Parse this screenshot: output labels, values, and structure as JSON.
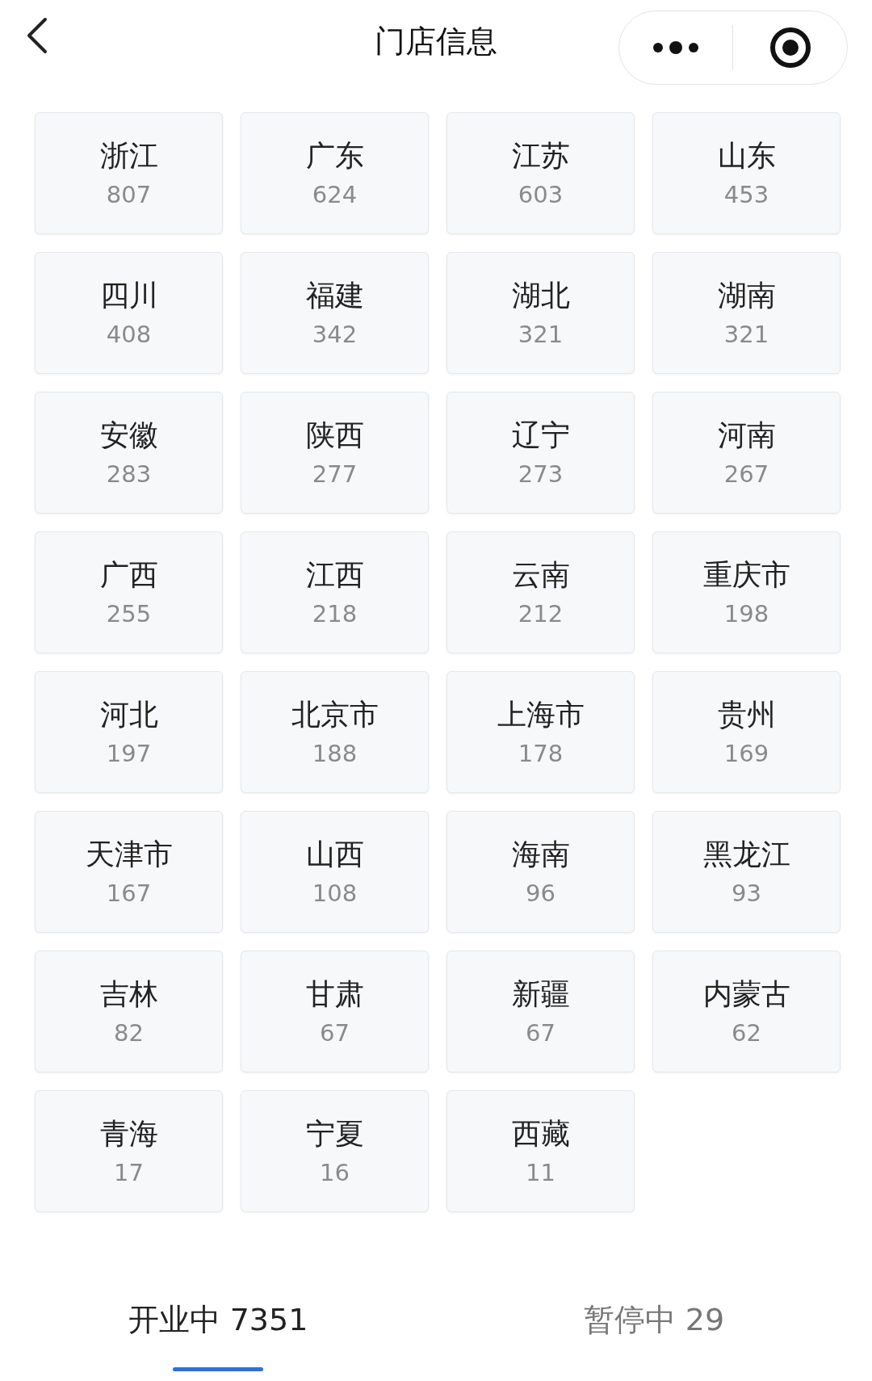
{
  "header": {
    "title": "门店信息"
  },
  "regions": [
    {
      "name": "浙江",
      "count": "807"
    },
    {
      "name": "广东",
      "count": "624"
    },
    {
      "name": "江苏",
      "count": "603"
    },
    {
      "name": "山东",
      "count": "453"
    },
    {
      "name": "四川",
      "count": "408"
    },
    {
      "name": "福建",
      "count": "342"
    },
    {
      "name": "湖北",
      "count": "321"
    },
    {
      "name": "湖南",
      "count": "321"
    },
    {
      "name": "安徽",
      "count": "283"
    },
    {
      "name": "陕西",
      "count": "277"
    },
    {
      "name": "辽宁",
      "count": "273"
    },
    {
      "name": "河南",
      "count": "267"
    },
    {
      "name": "广西",
      "count": "255"
    },
    {
      "name": "江西",
      "count": "218"
    },
    {
      "name": "云南",
      "count": "212"
    },
    {
      "name": "重庆市",
      "count": "198"
    },
    {
      "name": "河北",
      "count": "197"
    },
    {
      "name": "北京市",
      "count": "188"
    },
    {
      "name": "上海市",
      "count": "178"
    },
    {
      "name": "贵州",
      "count": "169"
    },
    {
      "name": "天津市",
      "count": "167"
    },
    {
      "name": "山西",
      "count": "108"
    },
    {
      "name": "海南",
      "count": "96"
    },
    {
      "name": "黑龙江",
      "count": "93"
    },
    {
      "name": "吉林",
      "count": "82"
    },
    {
      "name": "甘肃",
      "count": "67"
    },
    {
      "name": "新疆",
      "count": "67"
    },
    {
      "name": "内蒙古",
      "count": "62"
    },
    {
      "name": "青海",
      "count": "17"
    },
    {
      "name": "宁夏",
      "count": "16"
    },
    {
      "name": "西藏",
      "count": "11"
    }
  ],
  "tabs": [
    {
      "label": "开业中 7351",
      "selected": true
    },
    {
      "label": "暂停中 29",
      "selected": false
    }
  ]
}
